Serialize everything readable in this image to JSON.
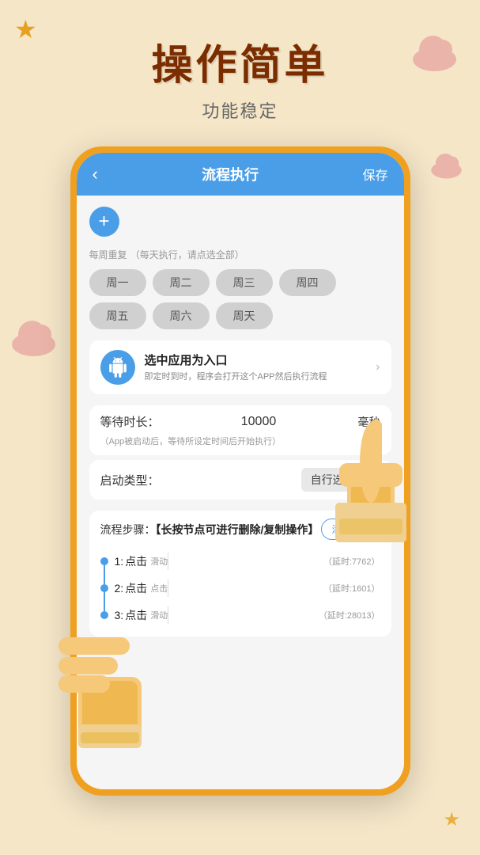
{
  "header": {
    "main_title": "操作简单",
    "sub_title": "功能稳定"
  },
  "app": {
    "nav": {
      "back_icon": "‹",
      "title": "流程执行",
      "save_label": "保存"
    },
    "weekly_repeat": {
      "label": "每周重复",
      "hint": "（每天执行，请点选全部）",
      "days": [
        "周一",
        "周二",
        "周三",
        "周四",
        "周五",
        "周六",
        "周天"
      ]
    },
    "entry": {
      "icon_label": "android-icon",
      "title": "选中应用为入口",
      "description": "即定时到时，程序会打开这个APP然后执行流程"
    },
    "wait": {
      "label": "等待时长：",
      "value": "10000",
      "unit": "毫秒",
      "hint": "（App被启动后，等待所设定时间后开始执行）"
    },
    "start_type": {
      "label": "启动类型：",
      "value": "自行选择",
      "dropdown_icon": "▼"
    },
    "steps": {
      "label": "流程步骤：",
      "hint_bold": "【长按节点可进行删除/复制操作】",
      "add_group_label": "添加分组",
      "items": [
        {
          "index": 1,
          "action": "点击",
          "sub": "滑动",
          "delay": "（延时:7762）"
        },
        {
          "index": 2,
          "action": "点击",
          "sub": "点击",
          "delay": "（延时:1601）"
        },
        {
          "index": 3,
          "action": "点击",
          "sub": "滑动",
          "delay": "（延时:28013）"
        }
      ]
    }
  },
  "decorations": {
    "star_unicode": "★",
    "plus_unicode": "+"
  }
}
